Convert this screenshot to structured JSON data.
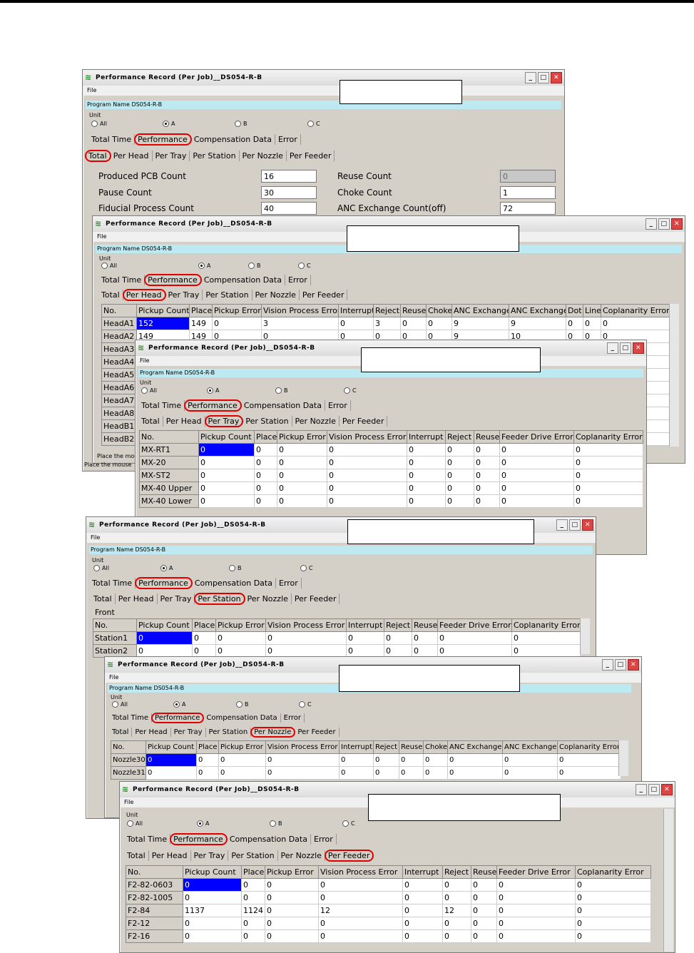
{
  "win1": {
    "title": "Performance Record (Per Job)__DS054-R-B",
    "menu": "File",
    "program": "Program Name DS054-R-B",
    "unit_label": "Unit",
    "radios": [
      "All",
      "A",
      "B",
      "C"
    ],
    "tabs": [
      "Total Time",
      "Performance",
      "Compensation Data",
      "Error"
    ],
    "subtabs": [
      "Total",
      "Per Head",
      "Per Tray",
      "Per Station",
      "Per Nozzle",
      "Per Feeder"
    ],
    "fields_left": [
      {
        "label": "Produced PCB Count",
        "value": "16"
      },
      {
        "label": "Pause Count",
        "value": "30"
      },
      {
        "label": "Fiducial Process Count",
        "value": "40"
      }
    ],
    "fields_right": [
      {
        "label": "Reuse Count",
        "value": "0"
      },
      {
        "label": "Choke Count",
        "value": "1"
      },
      {
        "label": "ANC Exchange Count(off)",
        "value": "72"
      }
    ]
  },
  "win2": {
    "title": "Performance Record (Per Job)__DS054-R-B",
    "menu": "File",
    "program": "Program Name DS054-R-B",
    "unit_label": "Unit",
    "radios": [
      "All",
      "A",
      "B",
      "C"
    ],
    "tabs": [
      "Total Time",
      "Performance",
      "Compensation Data",
      "Error"
    ],
    "subtabs": [
      "Total",
      "Per Head",
      "Per Tray",
      "Per Station",
      "Per Nozzle",
      "Per Feeder"
    ],
    "columns": [
      "No.",
      "Pickup Count",
      "Place",
      "Pickup Error",
      "Vision Process Error",
      "Interrupt",
      "Reject",
      "Reuse",
      "Choke",
      "ANC Exchange",
      "ANC Exchange",
      "Dot",
      "Line",
      "Coplanarity Error"
    ],
    "rows": [
      [
        "HeadA1",
        "152",
        "149",
        "0",
        "3",
        "0",
        "3",
        "0",
        "0",
        "9",
        "9",
        "0",
        "0",
        "0"
      ],
      [
        "HeadA2",
        "149",
        "149",
        "0",
        "0",
        "0",
        "0",
        "0",
        "0",
        "9",
        "10",
        "0",
        "0",
        "0"
      ]
    ],
    "rowheads_extra": [
      "HeadA3",
      "HeadA4",
      "HeadA5",
      "HeadA6",
      "HeadA7",
      "HeadA8",
      "HeadB1",
      "HeadB2"
    ],
    "status1": "Place the mou",
    "status2": "Place the mouse"
  },
  "win3": {
    "title": "Performance Record (Per Job)__DS054-R-B",
    "menu": "File",
    "program": "Program Name DS054-R-B",
    "unit_label": "Unit",
    "radios": [
      "All",
      "A",
      "B",
      "C"
    ],
    "tabs": [
      "Total Time",
      "Performance",
      "Compensation Data",
      "Error"
    ],
    "subtabs": [
      "Total",
      "Per Head",
      "Per Tray",
      "Per Station",
      "Per Nozzle",
      "Per Feeder"
    ],
    "columns": [
      "No.",
      "Pickup Count",
      "Place",
      "Pickup Error",
      "Vision Process Error",
      "Interrupt",
      "Reject",
      "Reuse",
      "Feeder Drive Error",
      "Coplanarity Error"
    ],
    "rows": [
      [
        "MX-RT1",
        "0",
        "0",
        "0",
        "0",
        "0",
        "0",
        "0",
        "0",
        "0"
      ],
      [
        "MX-20",
        "0",
        "0",
        "0",
        "0",
        "0",
        "0",
        "0",
        "0",
        "0"
      ],
      [
        "MX-ST2",
        "0",
        "0",
        "0",
        "0",
        "0",
        "0",
        "0",
        "0",
        "0"
      ],
      [
        "MX-40 Upper",
        "0",
        "0",
        "0",
        "0",
        "0",
        "0",
        "0",
        "0",
        "0"
      ],
      [
        "MX-40 Lower",
        "0",
        "0",
        "0",
        "0",
        "0",
        "0",
        "0",
        "0",
        "0"
      ]
    ]
  },
  "win4": {
    "title": "Performance Record (Per Job)__DS054-R-B",
    "menu": "File",
    "program": "Program Name DS054-R-B",
    "unit_label": "Unit",
    "radios": [
      "All",
      "A",
      "B",
      "C"
    ],
    "tabs": [
      "Total Time",
      "Performance",
      "Compensation Data",
      "Error"
    ],
    "subtabs": [
      "Total",
      "Per Head",
      "Per Tray",
      "Per Station",
      "Per Nozzle",
      "Per Feeder"
    ],
    "front": "Front",
    "columns": [
      "No.",
      "Pickup Count",
      "Place",
      "Pickup Error",
      "Vision Process Error",
      "Interrupt",
      "Reject",
      "Reuse",
      "Feeder Drive Error",
      "Coplanarity Error"
    ],
    "rows": [
      [
        "Station1",
        "0",
        "0",
        "0",
        "0",
        "0",
        "0",
        "0",
        "0",
        "0"
      ],
      [
        "Station2",
        "0",
        "0",
        "0",
        "0",
        "0",
        "0",
        "0",
        "0",
        "0"
      ]
    ]
  },
  "win5": {
    "title": "Performance Record (Per Job)__DS054-R-B",
    "menu": "File",
    "program": "Program Name DS054-R-B",
    "unit_label": "Unit",
    "radios": [
      "All",
      "A",
      "B",
      "C"
    ],
    "tabs": [
      "Total Time",
      "Performance",
      "Compensation Data",
      "Error"
    ],
    "subtabs": [
      "Total",
      "Per Head",
      "Per Tray",
      "Per Station",
      "Per Nozzle",
      "Per Feeder"
    ],
    "columns": [
      "No.",
      "Pickup Count",
      "Place",
      "Pickup Error",
      "Vision Process Error",
      "Interrupt",
      "Reject",
      "Reuse",
      "Choke",
      "ANC Exchange",
      "ANC Exchange",
      "Coplanarity Error"
    ],
    "rows": [
      [
        "Nozzle30",
        "0",
        "0",
        "0",
        "0",
        "0",
        "0",
        "0",
        "0",
        "0",
        "0",
        "0"
      ],
      [
        "Nozzle31",
        "0",
        "0",
        "0",
        "0",
        "0",
        "0",
        "0",
        "0",
        "0",
        "0",
        "0"
      ]
    ]
  },
  "win6": {
    "title": "Performance Record (Per Job)__DS054-R-B",
    "menu": "File",
    "unit_label": "Unit",
    "radios": [
      "All",
      "A",
      "B",
      "C"
    ],
    "tabs": [
      "Total Time",
      "Performance",
      "Compensation Data",
      "Error"
    ],
    "subtabs": [
      "Total",
      "Per Head",
      "Per Tray",
      "Per Station",
      "Per Nozzle",
      "Per Feeder"
    ],
    "columns": [
      "No.",
      "Pickup Count",
      "Place",
      "Pickup Error",
      "Vision Process Error",
      "Interrupt",
      "Reject",
      "Reuse",
      "Feeder Drive Error",
      "Coplanarity Error"
    ],
    "rows": [
      [
        "F2-82-0603",
        "0",
        "0",
        "0",
        "0",
        "0",
        "0",
        "0",
        "0",
        "0"
      ],
      [
        "F2-82-1005",
        "0",
        "0",
        "0",
        "0",
        "0",
        "0",
        "0",
        "0",
        "0"
      ],
      [
        "F2-84",
        "1137",
        "1124",
        "0",
        "12",
        "0",
        "12",
        "0",
        "0",
        "0"
      ],
      [
        "F2-12",
        "0",
        "0",
        "0",
        "0",
        "0",
        "0",
        "0",
        "0",
        "0"
      ],
      [
        "F2-16",
        "0",
        "0",
        "0",
        "0",
        "0",
        "0",
        "0",
        "0",
        "0"
      ]
    ]
  },
  "colors": {
    "highlight_circle": "#e00000",
    "selected_cell": "#0000ff",
    "program_bar": "#bdeaf2"
  }
}
